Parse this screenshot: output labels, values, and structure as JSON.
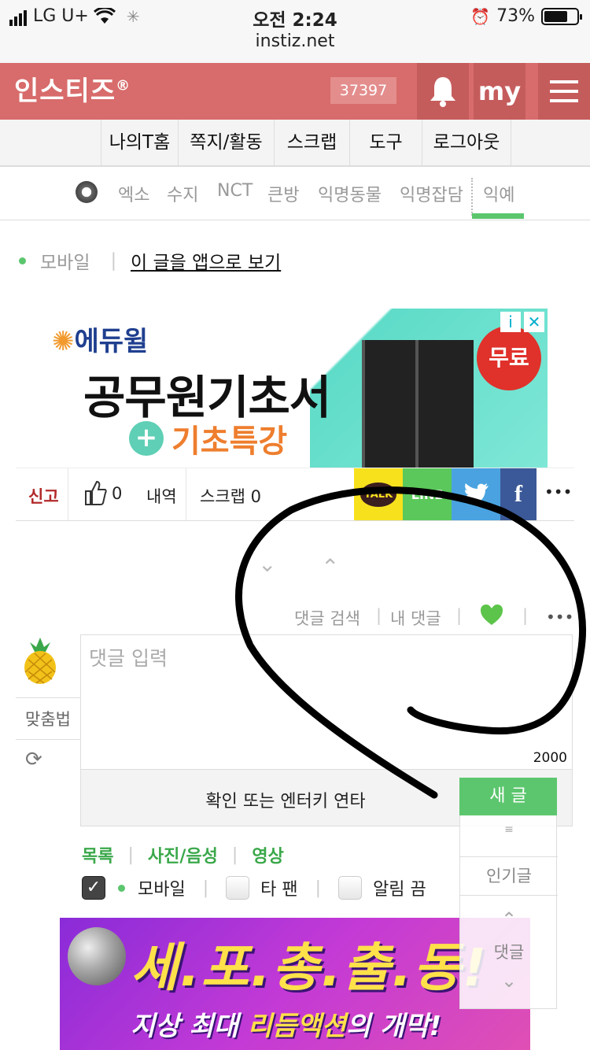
{
  "status": {
    "carrier": "LG U+",
    "time": "오전 2:24",
    "url": "instiz.net",
    "battery": "73%",
    "battery_fraction": 0.73
  },
  "header": {
    "logo": "인스티즈",
    "logo_mark": "®",
    "count": "37397",
    "my": "my"
  },
  "menu": [
    "나의T홈",
    "쪽지/활동",
    "스크랩",
    "도구",
    "로그아웃"
  ],
  "subnav": [
    "엑소",
    "수지",
    "NCT",
    "큰방",
    "익명동물",
    "익명잡담",
    "익예"
  ],
  "mobile_line": {
    "label": "모바일",
    "sep": "|",
    "app_link": "이 글을 앱으로 보기"
  },
  "ad_top": {
    "brand": "에듀윌",
    "title": "공무원기초서",
    "subtitle": "기초특강",
    "plus": "+",
    "badge": "무료",
    "info": "i",
    "close": "✕"
  },
  "action_bar": {
    "report": "신고",
    "likes": "0",
    "history": "내역",
    "scrap": "스크랩 0",
    "share": [
      "TALK",
      "LINE",
      "",
      "f"
    ],
    "more": "•••"
  },
  "comment_tools": {
    "search": "댓글 검색",
    "mine": "내 댓글",
    "sep": "|",
    "more": "•••"
  },
  "comment_box": {
    "spell": "맞춤법",
    "placeholder": "댓글 입력",
    "counter": "2000",
    "submit_hint": "확인 또는 엔터키 연타"
  },
  "side_panel": {
    "new_post": "새 글",
    "menu_icon": "≡",
    "popular": "인기글",
    "comments": "댓글"
  },
  "tabs": [
    "목록",
    "사진/음성",
    "영상"
  ],
  "tab_sep": "|",
  "options": {
    "mobile": "모바일",
    "other_fan": "타 팬",
    "notify_off": "알림 끔"
  },
  "banner": {
    "title": "세.포.총.출.동!",
    "subtitle_pre": "지상 최대 ",
    "subtitle_hl": "리듬액션",
    "subtitle_post": "의 개막!"
  },
  "colors": {
    "header": "#d86b6b",
    "accent_green": "#5cc66e",
    "kakao": "#f7e11d",
    "line": "#5ac85a",
    "twitter": "#4aa3e0",
    "facebook": "#3b5998"
  }
}
